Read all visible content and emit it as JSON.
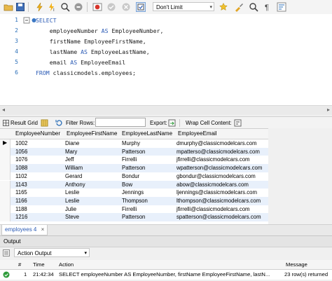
{
  "toolbar": {
    "limit_label": "Don't Limit"
  },
  "editor": {
    "lines": [
      {
        "num": "1",
        "pre": "",
        "kw": "SELECT",
        "post": ""
      },
      {
        "num": "2",
        "pre": "    employeeNumber ",
        "kw": "AS",
        "post": " EmployeeNumber,"
      },
      {
        "num": "3",
        "pre": "    firstName EmployeeFirstName,",
        "kw": "",
        "post": ""
      },
      {
        "num": "4",
        "pre": "    lastName ",
        "kw": "AS",
        "post": " EmployeeLastName,"
      },
      {
        "num": "5",
        "pre": "    email ",
        "kw": "AS",
        "post": " EmployeeEmail"
      },
      {
        "num": "6",
        "pre": "",
        "kw": "FROM",
        "post": " classicmodels.employees;"
      }
    ]
  },
  "result_toolbar": {
    "result_grid": "Result Grid",
    "filter_rows": "Filter Rows:",
    "export": "Export:",
    "wrap_cell": "Wrap Cell Content:"
  },
  "grid": {
    "columns": [
      "EmployeeNumber",
      "EmployeeFirstName",
      "EmployeeLastName",
      "EmployeeEmail"
    ],
    "rows": [
      [
        "1002",
        "Diane",
        "Murphy",
        "dmurphy@classicmodelcars.com"
      ],
      [
        "1056",
        "Mary",
        "Patterson",
        "mpatterso@classicmodelcars.com"
      ],
      [
        "1076",
        "Jeff",
        "Firrelli",
        "jfirrelli@classicmodelcars.com"
      ],
      [
        "1088",
        "William",
        "Patterson",
        "wpatterson@classicmodelcars.com"
      ],
      [
        "1102",
        "Gerard",
        "Bondur",
        "gbondur@classicmodelcars.com"
      ],
      [
        "1143",
        "Anthony",
        "Bow",
        "abow@classicmodelcars.com"
      ],
      [
        "1165",
        "Leslie",
        "Jennings",
        "ljennings@classicmodelcars.com"
      ],
      [
        "1166",
        "Leslie",
        "Thompson",
        "lthompson@classicmodelcars.com"
      ],
      [
        "1188",
        "Julie",
        "Firrelli",
        "jfirrelli@classicmodelcars.com"
      ],
      [
        "1216",
        "Steve",
        "Patterson",
        "spatterson@classicmodelcars.com"
      ]
    ]
  },
  "result_tab": "employees 4",
  "output": {
    "title": "Output",
    "selector": "Action Output",
    "columns": {
      "hash": "#",
      "time": "Time",
      "action": "Action",
      "message": "Message"
    },
    "row": {
      "num": "1",
      "time": "21:42:34",
      "action": "SELECT  employeeNumber AS EmployeeNumber,     firstName EmployeeFirstName,     lastN...",
      "message": "23 row(s) returned"
    }
  },
  "colors": {
    "accent": "#2b5bb5",
    "success": "#2e9b3a",
    "alt_row": "#e8f0fb"
  }
}
